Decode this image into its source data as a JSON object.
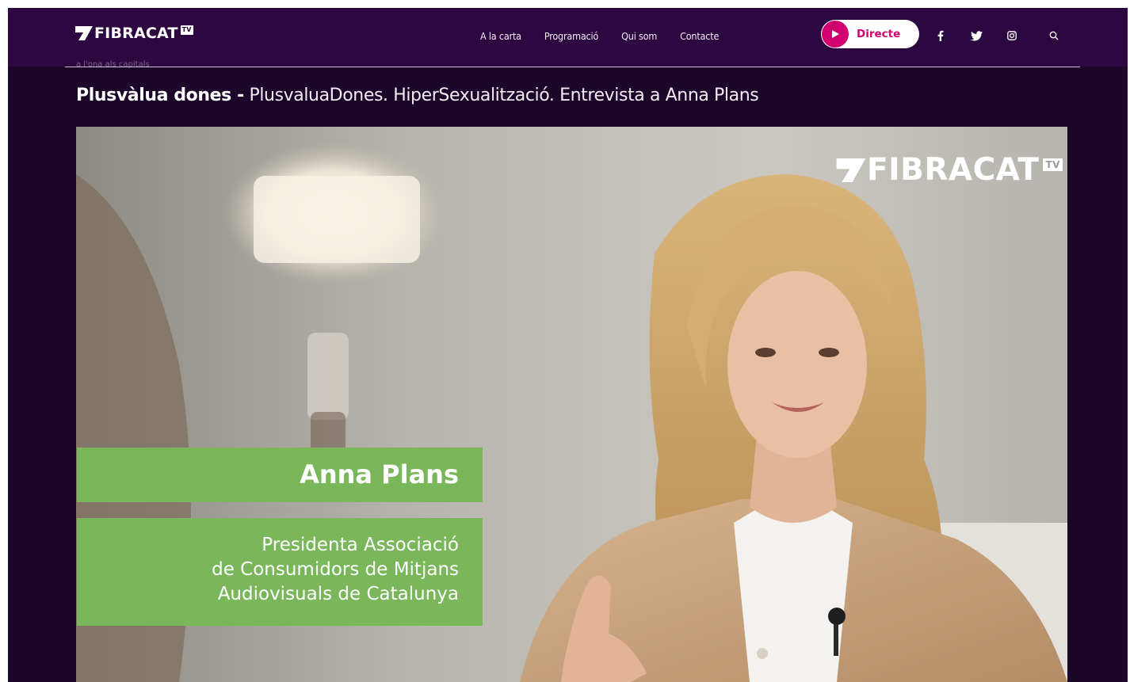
{
  "header": {
    "logo_text": "FIBRACAT",
    "logo_badge": "TV",
    "tagline": "a l'ona als capitals",
    "nav": [
      "A la carta",
      "Programació",
      "Qui som",
      "Contacte"
    ],
    "live_label": "Directe",
    "social_icons": [
      "facebook-icon",
      "twitter-icon",
      "instagram-icon",
      "search-icon"
    ],
    "colors": {
      "bar": "#2d0740",
      "background": "#1c0629",
      "live_accent": "#d2006e"
    }
  },
  "episode": {
    "program": "Plusvàlua dones -",
    "title": "PlusvaluaDones. HiperSexualització. Entrevista a Anna Plans"
  },
  "video": {
    "watermark": "FIBRACAT",
    "watermark_badge": "TV",
    "lower_third": {
      "name": "Anna Plans",
      "role_lines": [
        "Presidenta Associació",
        "de Consumidors de Mitjans",
        "Audiovisuals de Catalunya"
      ],
      "color": "#7ab75a"
    }
  }
}
